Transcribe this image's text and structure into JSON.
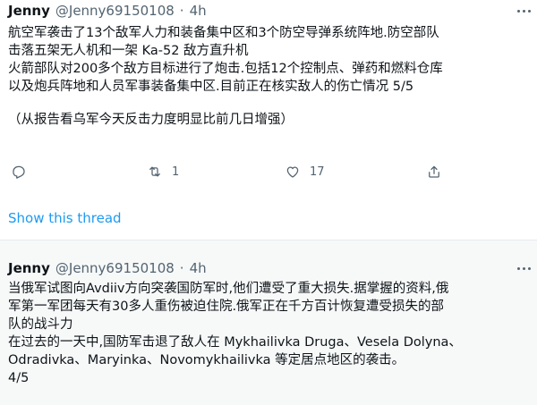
{
  "tweets": [
    {
      "name": "Jenny",
      "handle": "@Jenny69150108",
      "separator": "·",
      "time": "4h",
      "lines": [
        "航空军袭击了13个敌军人力和装备集中区和3个防空导弹系统阵地.防空部队",
        "击落五架无人机和一架 Ka-52 敌方直升机",
        "火箭部队对200多个敌方目标进行了炮击.包括12个控制点、弹药和燃料仓库",
        "以及炮兵阵地和人员军事装备集中区.目前正在核实敌人的伤亡情况 5/5"
      ],
      "note": "（从报告看乌军今天反击力度明显比前几日增强）",
      "actions": {
        "reply_count": "",
        "retweet_count": "1",
        "like_count": "17"
      },
      "show_thread": "Show this thread"
    },
    {
      "name": "Jenny",
      "handle": "@Jenny69150108",
      "separator": "·",
      "time": "4h",
      "lines": [
        "当俄军试图向Avdiiv方向突袭国防军时,他们遭受了重大损失.据掌握的资料,俄",
        "军第一军团每天有30多人重伤被迫住院.俄军正在千方百计恢复遭受损失的部",
        "队的战斗力",
        "在过去的一天中,国防军击退了敌人在 Mykhailivka Druga、Vesela Dolyna、",
        "Odradivka、Maryinka、Novomykhailivka 等定居点地区的袭击。",
        "4/5"
      ]
    }
  ],
  "icons": {
    "reply": "reply-icon",
    "retweet": "retweet-icon",
    "like": "heart-icon",
    "share": "share-icon",
    "more": "more-options-icon"
  },
  "colors": {
    "text": "#0f1419",
    "secondary": "#536471",
    "link": "#1d9bf0",
    "thread_bg": "#f7f9f9",
    "divider": "#e6ecf0"
  }
}
